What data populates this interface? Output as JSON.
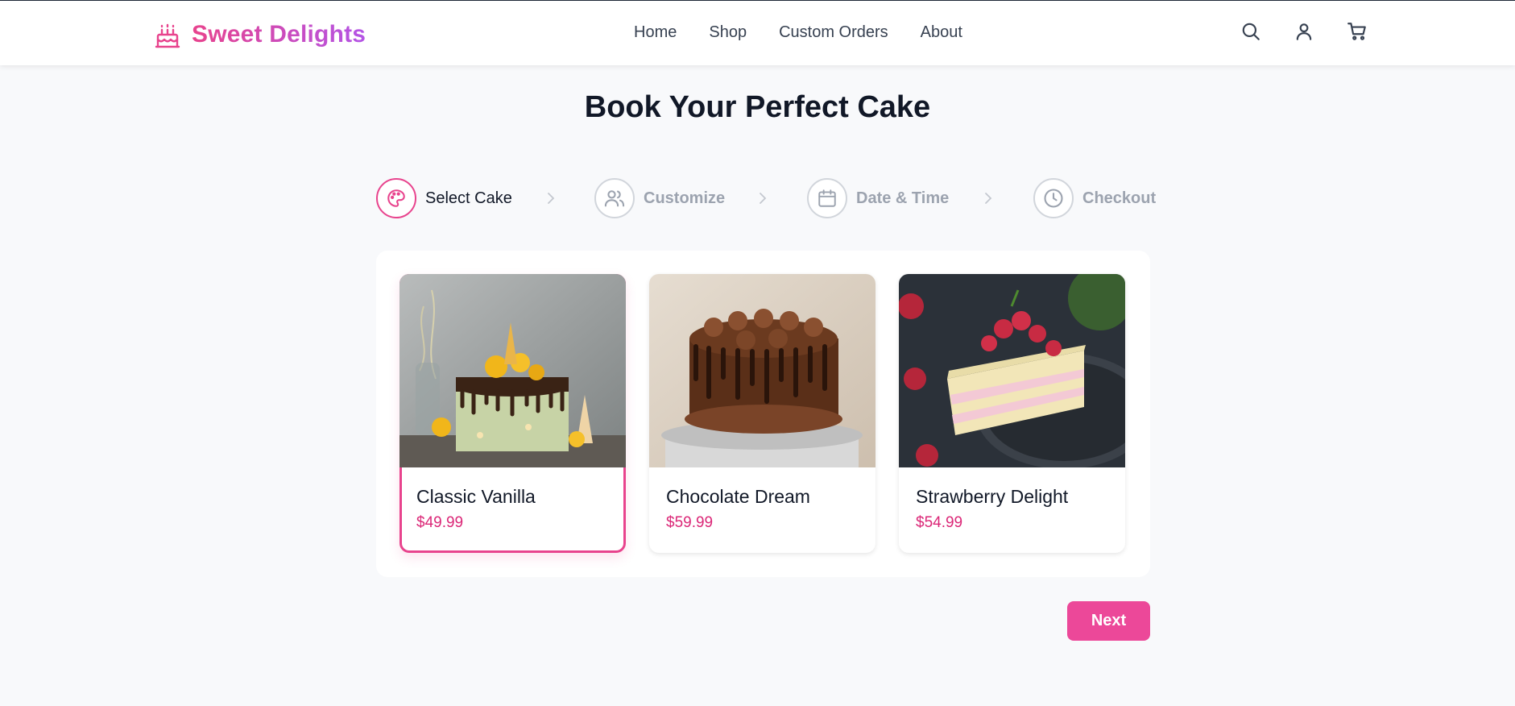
{
  "brand": {
    "name": "Sweet Delights",
    "icon": "cake-icon",
    "color": "#e8438d"
  },
  "nav": [
    {
      "label": "Home"
    },
    {
      "label": "Shop"
    },
    {
      "label": "Custom Orders"
    },
    {
      "label": "About"
    }
  ],
  "header_actions": [
    {
      "icon": "search-icon"
    },
    {
      "icon": "user-icon"
    },
    {
      "icon": "cart-icon"
    }
  ],
  "page": {
    "title": "Book Your Perfect Cake"
  },
  "steps": [
    {
      "label": "Select Cake",
      "icon": "palette-icon",
      "active": true
    },
    {
      "label": "Customize",
      "icon": "users-icon",
      "active": false
    },
    {
      "label": "Date & Time",
      "icon": "calendar-icon",
      "active": false
    },
    {
      "label": "Checkout",
      "icon": "clock-icon",
      "active": false
    }
  ],
  "cakes": [
    {
      "name": "Classic Vanilla",
      "price": "$49.99",
      "selected": true,
      "image": "vanilla-drip-cake-photo"
    },
    {
      "name": "Chocolate Dream",
      "price": "$59.99",
      "selected": false,
      "image": "chocolate-cake-photo"
    },
    {
      "name": "Strawberry Delight",
      "price": "$54.99",
      "selected": false,
      "image": "strawberry-cake-slice-photo"
    }
  ],
  "actions": {
    "next_label": "Next"
  },
  "colors": {
    "accent": "#ec4899",
    "price": "#db2777",
    "muted": "#9ca3af"
  }
}
